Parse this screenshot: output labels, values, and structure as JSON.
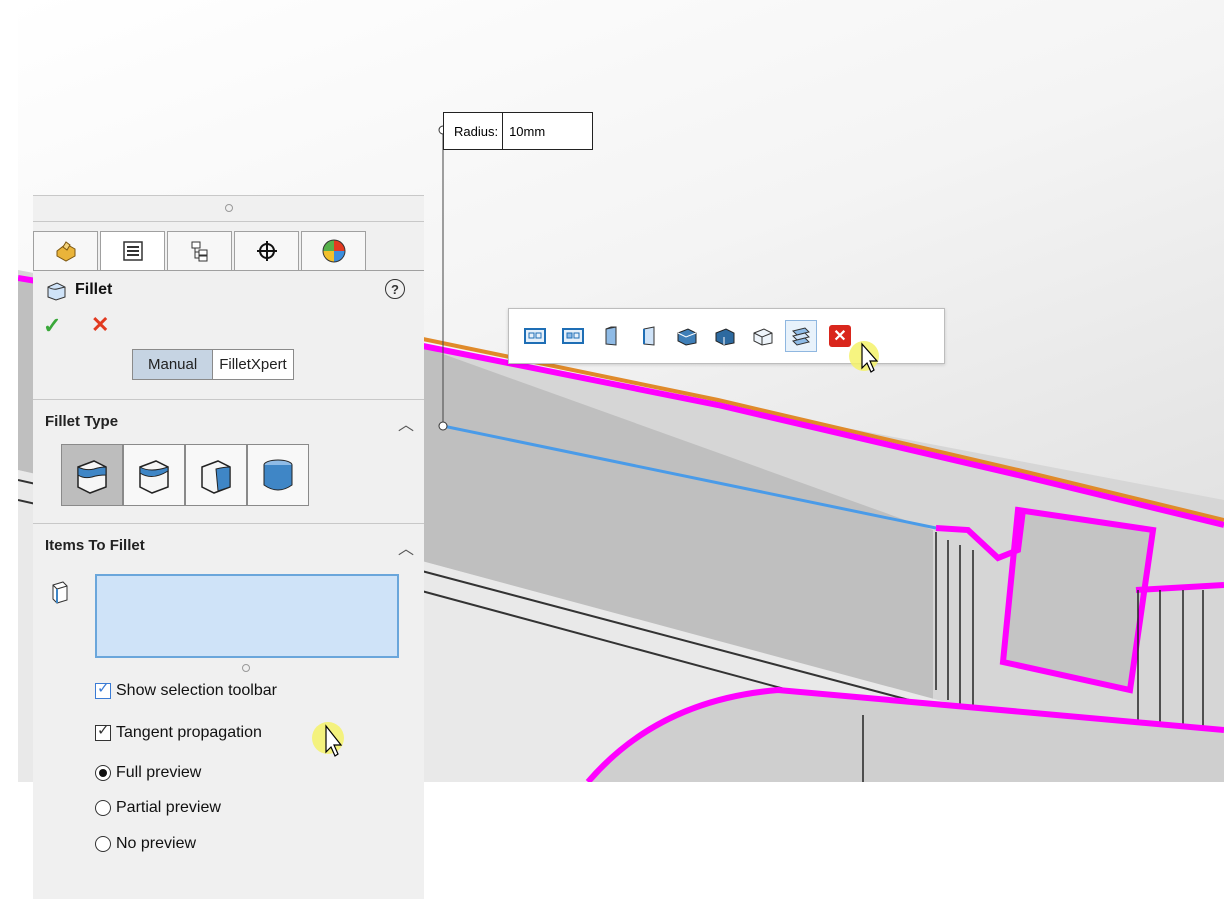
{
  "dimension": {
    "label": "Radius:",
    "value": "10mm"
  },
  "selection_toolbar": {
    "icons": [
      "select-loop-icon",
      "select-loop-alt-icon",
      "select-face-edges-icon",
      "select-face-edges-alt-icon",
      "select-feature-edges-icon",
      "select-feature-edges-alt-icon",
      "select-all-edges-icon",
      "select-connected-icon"
    ],
    "close_icon": "close-icon"
  },
  "panel": {
    "tabs": [
      "feature-manager-icon",
      "property-manager-icon",
      "configuration-manager-icon",
      "dimxpert-icon",
      "display-manager-icon"
    ],
    "title": "Fillet",
    "help": "?",
    "ok": "✓",
    "cancel": "✕",
    "mode_manual": "Manual",
    "mode_filletxpert": "FilletXpert",
    "fillet_type_header": "Fillet Type",
    "fillet_types": [
      "constant-size-fillet-icon",
      "variable-size-fillet-icon",
      "face-fillet-icon",
      "full-round-fillet-icon"
    ],
    "items_header": "Items To Fillet",
    "show_selection_toolbar": "Show selection toolbar",
    "tangent_propagation": "Tangent propagation",
    "full_preview": "Full preview",
    "partial_preview": "Partial preview",
    "no_preview": "No preview"
  },
  "colors": {
    "highlight": "#ff00ff",
    "selected_edge": "#4a9be8",
    "accent": "#c6d4e3"
  }
}
